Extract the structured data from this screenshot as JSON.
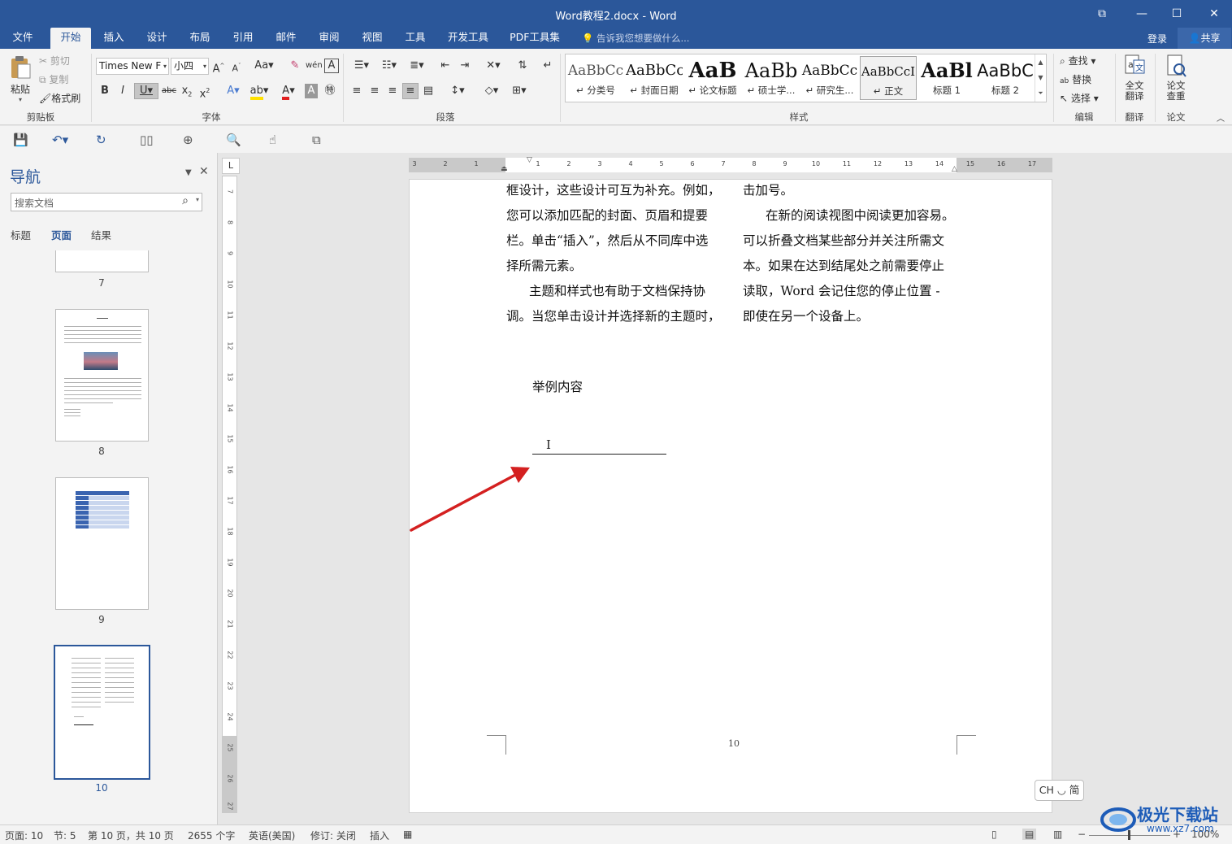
{
  "window": {
    "title": "Word教程2.docx - Word",
    "controls": {
      "restore_ribbon": "⧉",
      "minimize": "—",
      "maximize": "☐",
      "close": "✕"
    }
  },
  "menu": {
    "tabs": [
      "文件",
      "开始",
      "插入",
      "设计",
      "布局",
      "引用",
      "邮件",
      "审阅",
      "视图",
      "工具",
      "开发工具",
      "PDF工具集"
    ],
    "active_tab": "开始",
    "tell_me": "告诉我您想要做什么...",
    "login": "登录",
    "share": "共享"
  },
  "ribbon": {
    "clipboard": {
      "paste": "粘贴",
      "cut": "剪切",
      "copy": "复制",
      "format_painter": "格式刷",
      "label": "剪贴板"
    },
    "font": {
      "name": "Times New F",
      "size": "小四",
      "label": "字体"
    },
    "paragraph": {
      "label": "段落"
    },
    "styles": {
      "label": "样式",
      "items": [
        {
          "preview": "AaBbCc",
          "name": "↵ 分类号"
        },
        {
          "preview": "AaBbCc",
          "name": "↵ 封面日期"
        },
        {
          "preview": "AaB",
          "name": "↵ 论文标题"
        },
        {
          "preview": "AaBb",
          "name": "↵ 硕士学..."
        },
        {
          "preview": "AaBbCc",
          "name": "↵ 研究生..."
        },
        {
          "preview": "AaBbCcI",
          "name": "↵ 正文"
        },
        {
          "preview": "AaBl",
          "name": "标题 1"
        },
        {
          "preview": "AaBbC",
          "name": "标题 2"
        }
      ]
    },
    "editing": {
      "find": "查找",
      "replace": "替换",
      "select": "选择",
      "label": "编辑"
    },
    "translate": {
      "full": "全文翻译",
      "label": "翻译"
    },
    "paper": {
      "check": "论文查重",
      "label": "论文"
    }
  },
  "nav": {
    "title": "导航",
    "search_placeholder": "搜索文档",
    "tabs": [
      "标题",
      "页面",
      "结果"
    ],
    "active_tab": "页面",
    "pages": [
      "7",
      "8",
      "9",
      "10"
    ],
    "selected_page": "10"
  },
  "document": {
    "left_column": [
      "框设计，这些设计可互为补充。例如，",
      "您可以添加匹配的封面、页眉和提要",
      "栏。单击“插入”，然后从不同库中选",
      "择所需元素。",
      "主题和样式也有助于文档保持协",
      "调。当您单击设计并选择新的主题时，"
    ],
    "right_column": [
      "击加号。",
      "在新的阅读视图中阅读更加容易。",
      "可以折叠文档某些部分并关注所需文",
      "本。如果在达到结尾处之前需要停止",
      "读取，Word 会记住您的停止位置 -",
      "即使在另一个设备上。"
    ],
    "sample_text": "举例内容",
    "page_number": "10",
    "ime": "CH ◡ 简"
  },
  "status": {
    "page": "页面: 10",
    "section": "节: 5",
    "page_of": "第 10 页，共 10 页",
    "words": "2655 个字",
    "language": "英语(美国)",
    "track": "修订: 关闭",
    "insert": "插入",
    "zoom": "100%"
  },
  "watermark": {
    "name": "极光下载站",
    "url": "www.xz7.com"
  },
  "colors": {
    "brand": "#2b579a",
    "arrow": "#d42020"
  }
}
